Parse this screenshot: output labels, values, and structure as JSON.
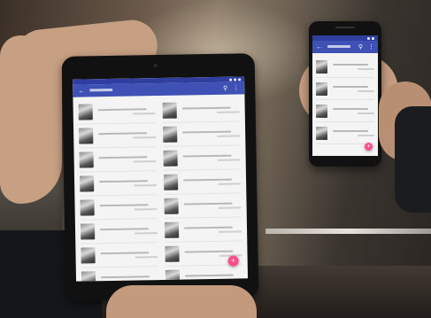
{
  "tablet": {
    "app_title": "",
    "rows": [
      {
        "name": "",
        "meta": ""
      },
      {
        "name": "",
        "meta": ""
      },
      {
        "name": "",
        "meta": ""
      },
      {
        "name": "",
        "meta": ""
      },
      {
        "name": "",
        "meta": ""
      },
      {
        "name": "",
        "meta": ""
      },
      {
        "name": "",
        "meta": ""
      },
      {
        "name": "",
        "meta": ""
      },
      {
        "name": "",
        "meta": ""
      },
      {
        "name": "",
        "meta": ""
      },
      {
        "name": "",
        "meta": ""
      },
      {
        "name": "",
        "meta": ""
      },
      {
        "name": "",
        "meta": ""
      },
      {
        "name": "",
        "meta": ""
      },
      {
        "name": "",
        "meta": ""
      },
      {
        "name": "",
        "meta": ""
      }
    ],
    "icons": {
      "menu": "menu-icon",
      "search": "search-icon",
      "more": "more-icon",
      "fab": "add-icon"
    }
  },
  "phone": {
    "app_title": "",
    "rows": [
      {
        "name": "",
        "meta": ""
      },
      {
        "name": "",
        "meta": ""
      },
      {
        "name": "",
        "meta": ""
      },
      {
        "name": "",
        "meta": ""
      }
    ],
    "icons": {
      "menu": "menu-icon",
      "search": "search-icon",
      "more": "more-icon",
      "fab": "add-icon"
    }
  },
  "colors": {
    "app_bar": "#3f51b5",
    "status_bar": "#303f9f",
    "fab": "#ff4f8b",
    "list_bg": "#f4f4f4"
  }
}
